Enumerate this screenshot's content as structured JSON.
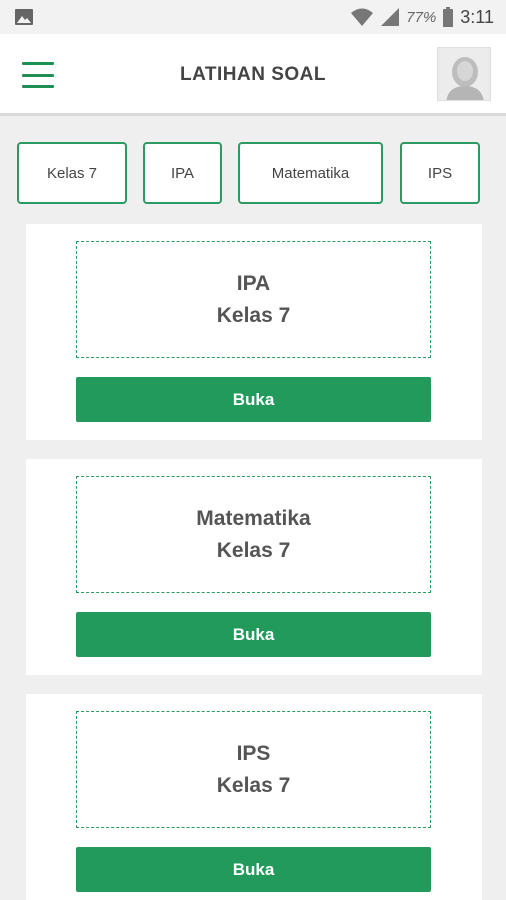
{
  "status_bar": {
    "battery": "77%",
    "time": "3:11",
    "icons": [
      "image-icon",
      "wifi-icon",
      "signal-icon",
      "battery-icon"
    ]
  },
  "app_bar": {
    "title": "LATIHAN SOAL",
    "menu_icon": "hamburger-menu-icon",
    "avatar_icon": "user-avatar-icon"
  },
  "filters": [
    {
      "label": "Kelas 7"
    },
    {
      "label": "IPA"
    },
    {
      "label": "Matematika"
    },
    {
      "label": "IPS"
    }
  ],
  "cards": [
    {
      "subject": "IPA",
      "class": "Kelas 7",
      "button": "Buka"
    },
    {
      "subject": "Matematika",
      "class": "Kelas 7",
      "button": "Buka"
    },
    {
      "subject": "IPS",
      "class": "Kelas 7",
      "button": "Buka"
    }
  ],
  "colors": {
    "accent": "#229a5c",
    "background": "#efefef"
  }
}
